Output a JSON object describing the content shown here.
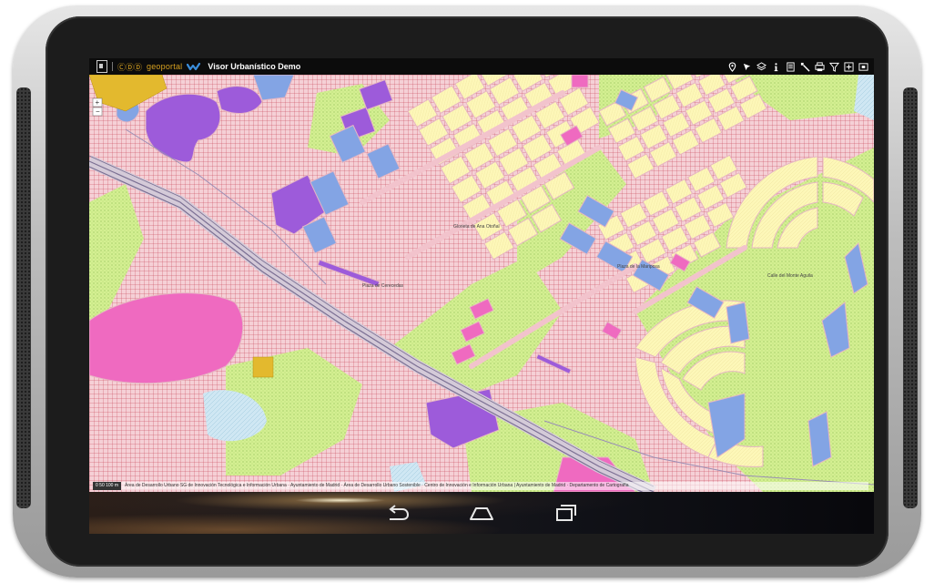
{
  "header": {
    "brand": "geoportal",
    "brand_mark": "ⒸⒹⒹ",
    "title": "Visor Urbanístico Demo"
  },
  "toolbar": {
    "icons": [
      "location-pin-icon",
      "pointer-icon",
      "layers-icon",
      "info-icon",
      "list-icon",
      "select-icon",
      "print-icon",
      "filter-icon",
      "zoom-box-icon",
      "fullscreen-icon"
    ]
  },
  "map": {
    "scale_label": "0 50 100 m",
    "attribution": "Área de Desarrollo Urbano SG de Innovación Tecnológica e Información Urbana · Ayuntamiento de Madrid · Área de Desarrollo Urbano Sostenible · Centro de Innovación e Información Urbana | Ayuntamiento de Madrid · Departamento de Cartografía",
    "labels": [
      "Glorieta de Ana Otoñal",
      "Plaza de la Mariposa",
      "Calle del Monte Aguila",
      "Plaza de Cerecedas"
    ]
  },
  "navbar": {
    "buttons": [
      "back-button",
      "home-button",
      "recents-button"
    ]
  },
  "colors": {
    "residential": "#fdf7b8",
    "commercial": "#9c5cd9",
    "equipment": "#83a4e4",
    "park": "#d2ef8e",
    "tertiary": "#ef6ac0",
    "road": "#e8b8c3",
    "industrial": "#e3b92e"
  }
}
